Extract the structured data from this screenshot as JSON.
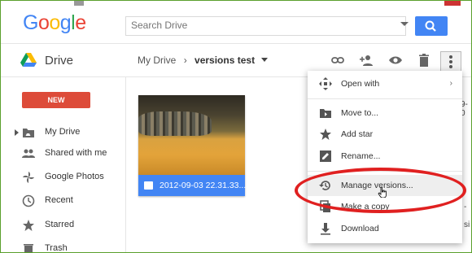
{
  "header": {
    "logo_letters": [
      {
        "ch": "G",
        "color": "#4285f4"
      },
      {
        "ch": "o",
        "color": "#ea4335"
      },
      {
        "ch": "o",
        "color": "#fbbc05"
      },
      {
        "ch": "g",
        "color": "#4285f4"
      },
      {
        "ch": "l",
        "color": "#34a853"
      },
      {
        "ch": "e",
        "color": "#ea4335"
      }
    ],
    "search_placeholder": "Search Drive"
  },
  "app_bar": {
    "app_name": "Drive",
    "breadcrumb_root": "My Drive",
    "breadcrumb_sep": "›",
    "breadcrumb_current": "versions test",
    "icons": [
      "link-icon",
      "add-person-icon",
      "eye-icon",
      "trash-icon",
      "more-vert-icon"
    ]
  },
  "sidebar": {
    "new_label": "NEW",
    "items": [
      {
        "label": "My Drive",
        "icon": "drive-folder-icon"
      },
      {
        "label": "Shared with me",
        "icon": "people-icon"
      },
      {
        "label": "Google Photos",
        "icon": "photos-pinwheel-icon"
      },
      {
        "label": "Recent",
        "icon": "clock-icon"
      },
      {
        "label": "Starred",
        "icon": "star-icon"
      },
      {
        "label": "Trash",
        "icon": "trash-icon"
      }
    ]
  },
  "file": {
    "name": "2012-09-03 22.31.33...."
  },
  "context_menu": {
    "items": [
      {
        "label": "Open with",
        "icon": "move-arrows-icon",
        "submenu": "›"
      },
      {
        "label": "Move to...",
        "icon": "folder-move-icon"
      },
      {
        "label": "Add star",
        "icon": "star-icon"
      },
      {
        "label": "Rename...",
        "icon": "pencil-icon"
      },
      {
        "label": "Manage versions...",
        "icon": "history-icon"
      },
      {
        "label": "Make a copy",
        "icon": "copy-icon"
      },
      {
        "label": "Download",
        "icon": "download-icon"
      }
    ]
  },
  "right_fragments": {
    "a": "9-0",
    "b": "-",
    "c": "si"
  },
  "colors": {
    "accent_blue": "#4285f4",
    "new_red": "#dd4b39",
    "highlight_oval": "#e02020"
  }
}
